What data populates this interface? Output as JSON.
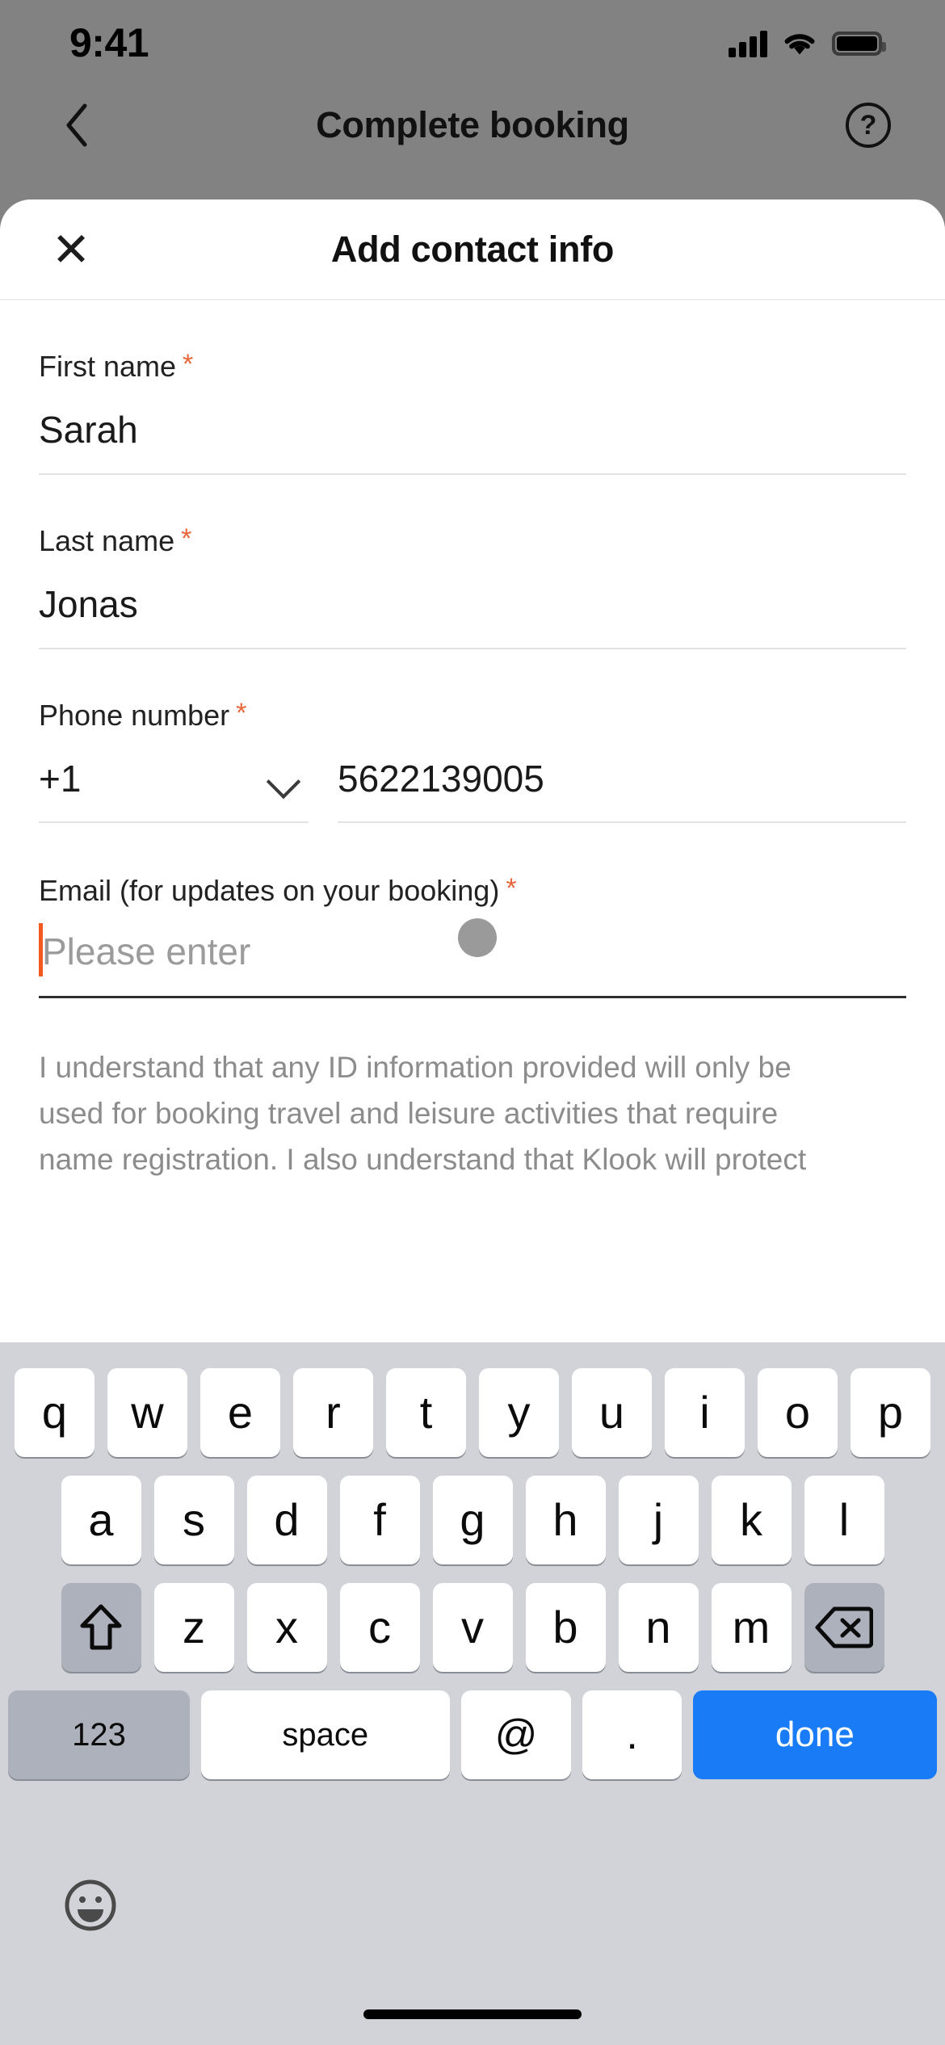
{
  "status_bar": {
    "time": "9:41",
    "signal_icon": "cellular-signal-icon",
    "wifi_icon": "wifi-icon",
    "battery_icon": "battery-icon"
  },
  "nav_bar": {
    "back_icon": "chevron-left-icon",
    "title": "Complete booking",
    "help_icon": "help-circle-icon",
    "help_glyph": "?"
  },
  "sheet": {
    "close_icon": "close-icon",
    "close_glyph": "✕",
    "title": "Add contact info"
  },
  "form": {
    "required_marker": "*",
    "first_name": {
      "label": "First name",
      "value": "Sarah",
      "required": true
    },
    "last_name": {
      "label": "Last name",
      "value": "Jonas",
      "required": true
    },
    "phone": {
      "label": "Phone number",
      "required": true,
      "country_code": "+1",
      "dropdown_icon": "chevron-down-icon",
      "number": "5622139005"
    },
    "email": {
      "label": "Email (for updates on your booking)",
      "required": true,
      "value": "",
      "placeholder": "Please enter",
      "focused": true
    }
  },
  "disclaimer": {
    "lines": [
      "I understand that any ID information provided will only be",
      "used for booking travel and leisure activities that require",
      "name registration. I also understand that Klook will protect"
    ]
  },
  "keyboard": {
    "row1": [
      "q",
      "w",
      "e",
      "r",
      "t",
      "y",
      "u",
      "i",
      "o",
      "p"
    ],
    "row2": [
      "a",
      "s",
      "d",
      "f",
      "g",
      "h",
      "j",
      "k",
      "l"
    ],
    "row3_letters": [
      "z",
      "x",
      "c",
      "v",
      "b",
      "n",
      "m"
    ],
    "shift_icon": "shift-key-icon",
    "backspace_icon": "backspace-key-icon",
    "numeric_label": "123",
    "space_label": "space",
    "at_label": "@",
    "dot_label": ".",
    "done_label": "done",
    "emoji_icon": "emoji-key-icon",
    "home_indicator_icon": "home-indicator"
  },
  "colors": {
    "accent_orange": "#f05a1e",
    "required_asterisk": "#e8663a",
    "done_blue": "#1a7bf7",
    "keyboard_bg": "#d1d3d9",
    "modifier_key": "#adb1bb",
    "backdrop": "#828282"
  }
}
